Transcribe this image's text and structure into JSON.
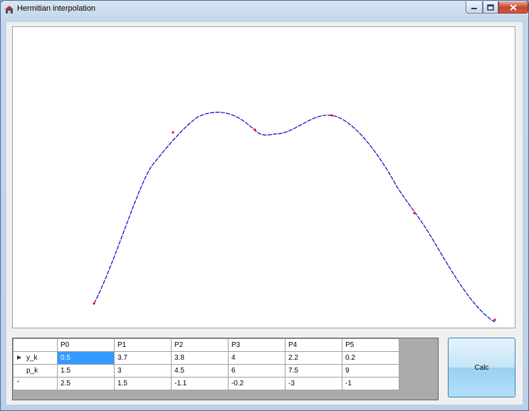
{
  "window": {
    "title": "Hermitian interpolation",
    "icon": "app-icon",
    "controls": [
      "minimize-icon",
      "maximize-icon",
      "close-icon"
    ]
  },
  "plot": {
    "curve_color": "#0000cc",
    "point_color": "#ff0000",
    "line_style": "dashed"
  },
  "grid": {
    "columns": [
      "P0",
      "P1",
      "P2",
      "P3",
      "P4",
      "P5"
    ],
    "rows": [
      {
        "label": "y_k",
        "marker": "▶",
        "values": [
          "0.5",
          "3.7",
          "3.8",
          "4",
          "2.2",
          "0.2"
        ],
        "selected_col": 0
      },
      {
        "label": "p_k",
        "marker": "",
        "values": [
          "1.5",
          "3",
          "4.5",
          "6",
          "7.5",
          "9"
        ]
      },
      {
        "label": "",
        "marker": "*",
        "values": [
          "2.5",
          "1.5",
          "-1.1",
          "-0.2",
          "-3",
          "-1"
        ]
      }
    ],
    "selection_color": "#3399ff"
  },
  "calc_button": {
    "label": "Calc"
  }
}
